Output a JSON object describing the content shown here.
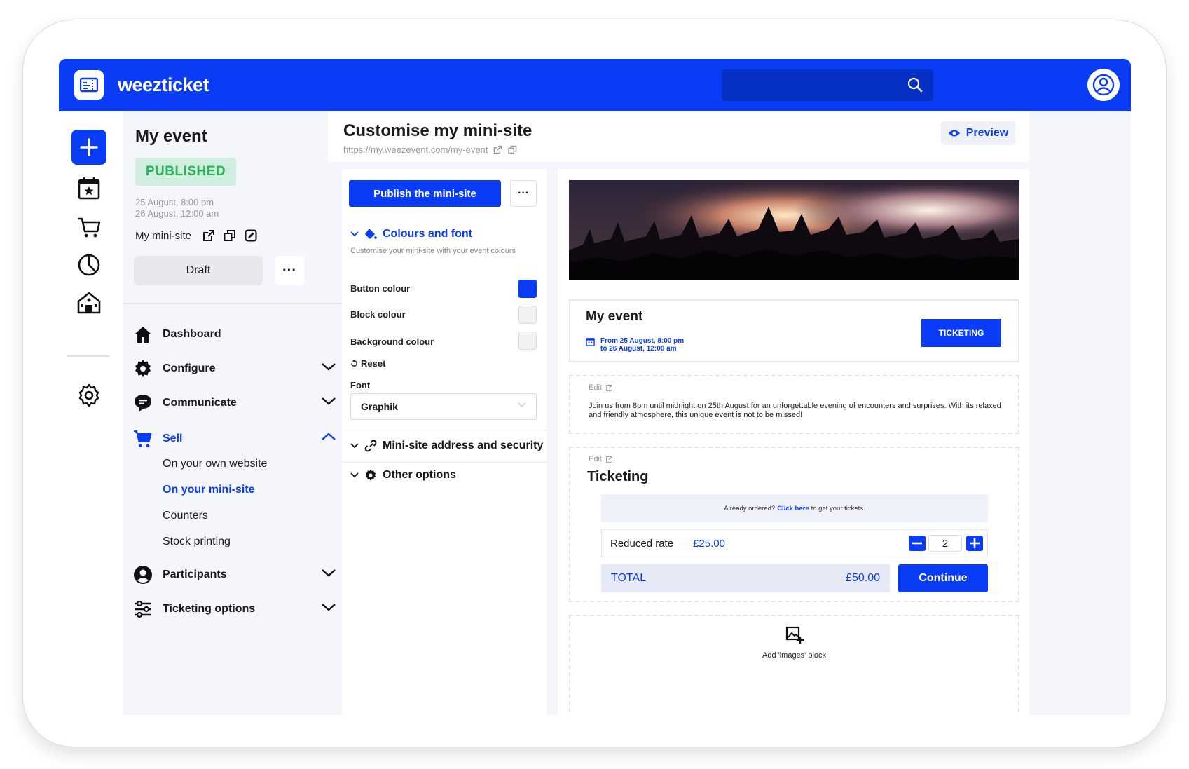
{
  "brand": {
    "name": "weezticket"
  },
  "colors": {
    "accent": "#0a3cf5",
    "published": "#2bb45a",
    "published_bg": "#cfeedd"
  },
  "rail": {
    "icons": [
      "plus-icon",
      "calendar-star-icon",
      "cart-icon",
      "pie-chart-icon",
      "venue-icon",
      "settings-icon"
    ]
  },
  "event": {
    "title": "My event",
    "status": "PUBLISHED",
    "date_start": "25 August, 8:00 pm",
    "date_end": "26 August, 12:00 am",
    "mini_site_label": "My mini-site",
    "draft_label": "Draft",
    "more_label": "···"
  },
  "nav": {
    "dashboard": "Dashboard",
    "configure": "Configure",
    "communicate": "Communicate",
    "sell": "Sell",
    "sell_sub": [
      "On your own website",
      "On your mini-site",
      "Counters",
      "Stock printing"
    ],
    "participants": "Participants",
    "ticketing_options": "Ticketing options"
  },
  "header": {
    "title": "Customise my mini-site",
    "url": "https://my.weezevent.com/my-event",
    "preview_label": "Preview"
  },
  "config": {
    "publish_label": "Publish the mini-site",
    "more_label": "···",
    "colours_title": "Colours and font",
    "colours_desc": "Customise your mini-site with your event colours",
    "button_colour_label": "Button colour",
    "button_colour": "#0a3cf5",
    "block_colour_label": "Block colour",
    "block_colour": "#f2f2f4",
    "background_colour_label": "Background colour",
    "background_colour": "#f2f2f4",
    "reset_label": "Reset",
    "font_label": "Font",
    "font_value": "Graphik",
    "address_title": "Mini-site address and security",
    "other_title": "Other options"
  },
  "preview": {
    "event_title": "My event",
    "date_line1": "From 25 August, 8:00 pm",
    "date_line2": "to 26 August, 12:00 am",
    "ticketing_button": "TICKETING",
    "edit_label": "Edit",
    "description": "Join us from 8pm until midnight on 25th August for an unforgettable evening of encounters and surprises. With its relaxed and friendly atmosphere, this unique event is not to be missed!",
    "ticketing_title": "Ticketing",
    "already_ordered": "Already ordered?",
    "click_here": "Click here",
    "get_tickets": "to get your tickets.",
    "rate_name": "Reduced rate",
    "rate_price": "£25.00",
    "quantity": "2",
    "total_label": "TOTAL",
    "total_value": "£50.00",
    "continue_label": "Continue",
    "add_images_label": "Add 'images' block"
  }
}
